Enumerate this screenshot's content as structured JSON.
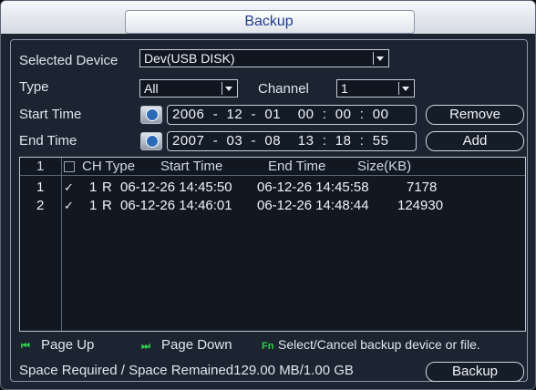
{
  "title": "Backup",
  "fields": {
    "selected_device_label": "Selected Device",
    "selected_device_value": "Dev(USB DISK)",
    "type_label": "Type",
    "type_value": "All",
    "channel_label": "Channel",
    "channel_value": "1",
    "start_time_label": "Start Time",
    "start_time_value": "2006  -  12  -  01    00  :  00  :  00",
    "end_time_label": "End Time",
    "end_time_value": "2007  -  03  -  08    13  :  18  :  55"
  },
  "buttons": {
    "remove": "Remove",
    "add": "Add",
    "backup": "Backup"
  },
  "table": {
    "header": {
      "index": "1",
      "ch_type": "CH Type",
      "start_time": "Start Time",
      "end_time": "End Time",
      "size": "Size(KB)"
    },
    "rows": [
      {
        "index": "1",
        "checked": true,
        "ch": "1",
        "type": "R",
        "start": "06-12-26 14:45:50",
        "end": "06-12-26 14:45:58",
        "size": "7178"
      },
      {
        "index": "2",
        "checked": true,
        "ch": "1",
        "type": "R",
        "start": "06-12-26 14:46:01",
        "end": "06-12-26 14:48:44",
        "size": "124930"
      }
    ]
  },
  "footer": {
    "page_up_icon": "⏮",
    "page_up": "Page Up",
    "page_down_icon": "⏭",
    "page_down": "Page Down",
    "fn_icon": "Fn",
    "fn_hint": "Select/Cancel backup device or file.",
    "space_info": "Space Required / Space Remained129.00 MB/1.00 GB"
  },
  "colors": {
    "background": "#1b2430",
    "title_text": "#1f3e8c",
    "legend_icon": "#2ed04a"
  }
}
